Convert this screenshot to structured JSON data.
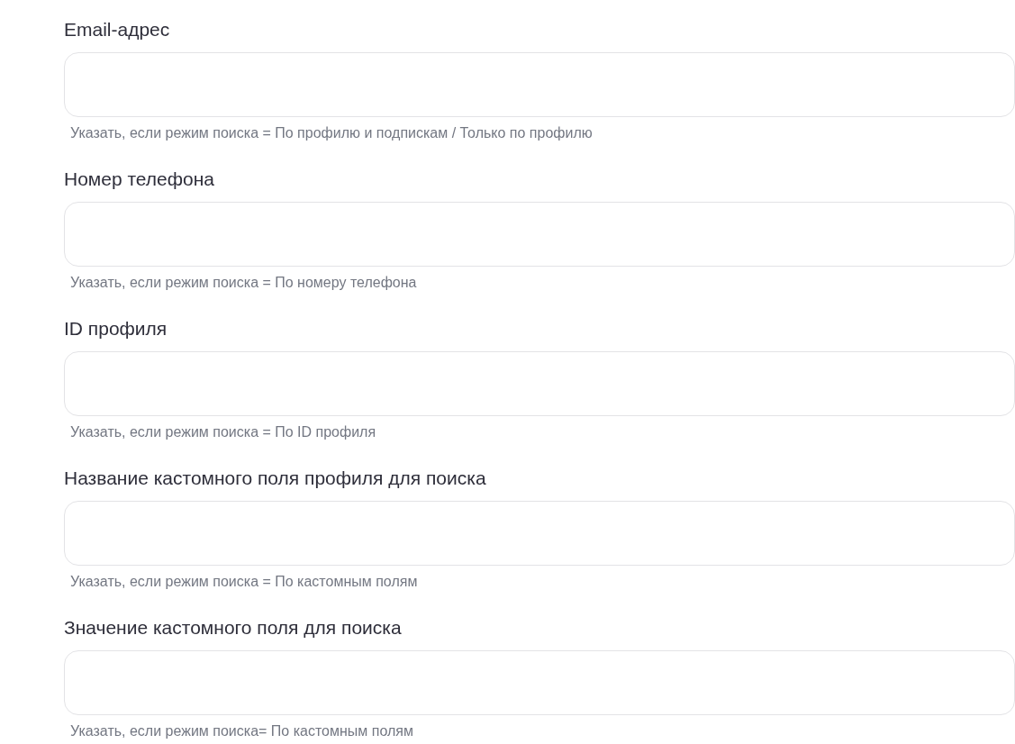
{
  "fields": [
    {
      "label": "Email-адрес",
      "hint": "Указать, если режим поиска = По профилю и подпискам / Только по профилю"
    },
    {
      "label": "Номер телефона",
      "hint": "Указать, если режим поиска = По номеру телефона"
    },
    {
      "label": "ID профиля",
      "hint": "Указать, если режим поиска = По ID профиля"
    },
    {
      "label": "Название кастомного поля профиля для поиска",
      "hint": "Указать, если режим поиска = По кастомным полям"
    },
    {
      "label": "Значение кастомного поля для поиска",
      "hint": "Указать, если режим поиска= По кастомным полям"
    }
  ]
}
